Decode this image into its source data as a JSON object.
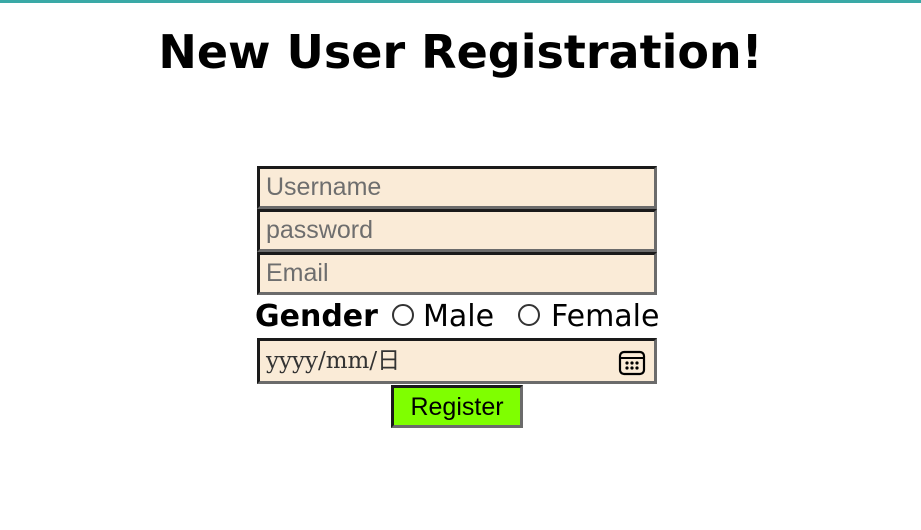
{
  "page": {
    "title": "New User Registration!",
    "accent_color": "#3aa9a6"
  },
  "form": {
    "username": {
      "value": "",
      "placeholder": "Username"
    },
    "password": {
      "value": "",
      "placeholder": "password"
    },
    "email": {
      "value": "",
      "placeholder": "Email"
    },
    "gender": {
      "label": "Gender",
      "options": [
        {
          "label": "Male",
          "selected": false
        },
        {
          "label": "Female",
          "selected": false
        }
      ]
    },
    "date": {
      "placeholder": "yyyy/mm/日",
      "icon": "calendar-icon"
    },
    "submit_label": "Register",
    "field_background": "#faebd7",
    "button_color": "#7fff00"
  }
}
